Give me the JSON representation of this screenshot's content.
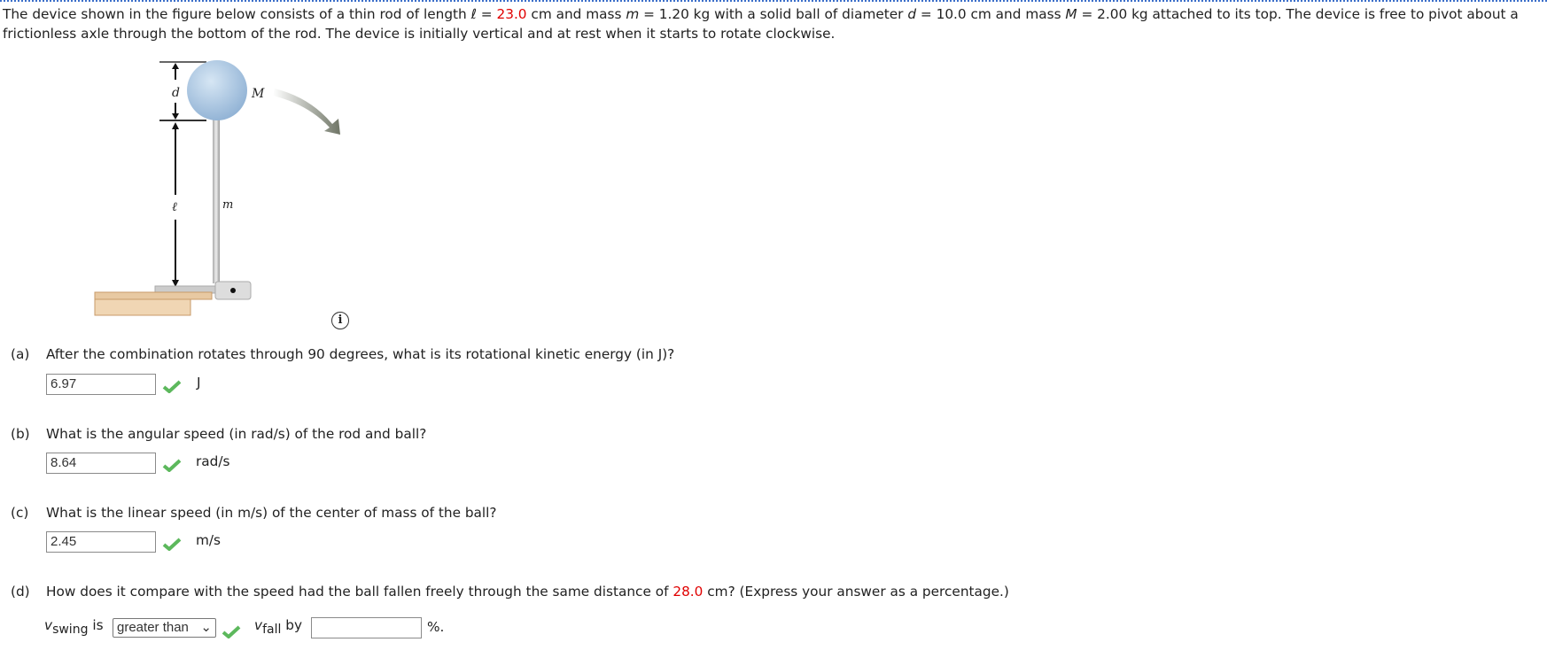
{
  "problem": {
    "t1": "The device shown in the figure below consists of a thin rod of length ",
    "ell": "ℓ",
    "t2": " = ",
    "length": "23.0",
    "t3": " cm and mass ",
    "m": "m",
    "t4": " = 1.20 kg with a solid ball of diameter ",
    "d": "d",
    "t5": " = 10.0 cm and mass ",
    "M": "M",
    "t6": " = 2.00 kg attached to its top. The device is free to pivot about a frictionless axle through the bottom of the rod. The device is initially vertical and at rest when it starts to rotate clockwise."
  },
  "figure": {
    "label_d": "d",
    "label_M": "M",
    "label_ell": "ℓ",
    "label_m": "m"
  },
  "info_icon": "i",
  "parts": {
    "a": {
      "label": "(a)",
      "question": "After the combination rotates through 90 degrees, what is its rotational kinetic energy (in J)?",
      "value": "6.97",
      "unit": "J",
      "status": "correct"
    },
    "b": {
      "label": "(b)",
      "question": "What is the angular speed (in rad/s) of the rod and ball?",
      "value": "8.64",
      "unit": "rad/s",
      "status": "correct"
    },
    "c": {
      "label": "(c)",
      "question": "What is the linear speed (in m/s) of the center of mass of the ball?",
      "value": "2.45",
      "unit": "m/s",
      "status": "correct"
    },
    "d": {
      "label": "(d)",
      "q1": "How does it compare with the speed had the ball fallen freely through the same distance of ",
      "distance": "28.0",
      "q2": " cm? (Express your answer as a percentage.)",
      "v": "v",
      "swing": "swing",
      "is": "is",
      "select_value": "greater than",
      "fall": "fall",
      "by": "by",
      "value": "",
      "unit": "%."
    }
  },
  "colors": {
    "highlight": "#e00000",
    "check": "#5cb85c"
  }
}
